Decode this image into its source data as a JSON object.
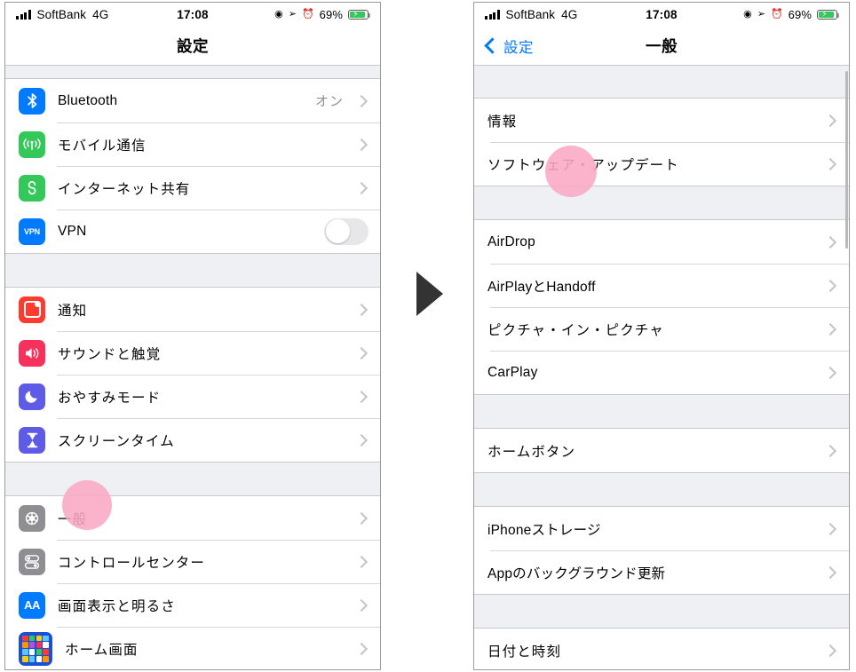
{
  "status_bar": {
    "carrier": "SoftBank",
    "network": "4G",
    "time": "17:08",
    "location_glyph": "◉",
    "navigation_glyph": "➢",
    "alarm_glyph": "⏰",
    "battery_percent": "69%",
    "battery_bolt": "⚡"
  },
  "colors": {
    "accent_blue": "#007aff",
    "highlight_pink": "#f9a8c3",
    "group_background": "#eff0f4",
    "separator": "#d6d6da",
    "chevron_gray": "#c4c4c6",
    "secondary_text": "#8e8e93"
  },
  "left_phone": {
    "nav": {
      "title": "設定"
    },
    "sections": [
      {
        "rows": [
          {
            "label": "Bluetooth",
            "value": "オン",
            "icon": "bluetooth-icon",
            "accessory": "chevron",
            "jp": false
          },
          {
            "label": "モバイル通信",
            "value": "",
            "icon": "cellular-icon",
            "accessory": "chevron",
            "jp": true
          },
          {
            "label": "インターネット共有",
            "value": "",
            "icon": "personal-hotspot-icon",
            "accessory": "chevron",
            "jp": true
          },
          {
            "label": "VPN",
            "value": "",
            "icon": "vpn-icon",
            "accessory": "toggle",
            "jp": false
          }
        ]
      },
      {
        "rows": [
          {
            "label": "通知",
            "value": "",
            "icon": "notifications-icon",
            "accessory": "chevron",
            "jp": true
          },
          {
            "label": "サウンドと触覚",
            "value": "",
            "icon": "sounds-haptics-icon",
            "accessory": "chevron",
            "jp": true
          },
          {
            "label": "おやすみモード",
            "value": "",
            "icon": "do-not-disturb-icon",
            "accessory": "chevron",
            "jp": true
          },
          {
            "label": "スクリーンタイム",
            "value": "",
            "icon": "screen-time-icon",
            "accessory": "chevron",
            "jp": true
          }
        ]
      },
      {
        "rows": [
          {
            "label": "一般",
            "value": "",
            "icon": "general-gear-icon",
            "accessory": "chevron",
            "jp": true
          },
          {
            "label": "コントロールセンター",
            "value": "",
            "icon": "control-center-icon",
            "accessory": "chevron",
            "jp": true
          },
          {
            "label": "画面表示と明るさ",
            "value": "",
            "icon": "display-brightness-icon",
            "accessory": "chevron",
            "jp": true
          },
          {
            "label": "ホーム画面",
            "value": "",
            "icon": "home-screen-icon",
            "accessory": "chevron",
            "jp": true
          }
        ]
      }
    ],
    "tap_highlight": {
      "label": "一般"
    }
  },
  "right_phone": {
    "nav": {
      "back_label": "設定",
      "title": "一般"
    },
    "sections": [
      {
        "rows": [
          {
            "label": "情報",
            "accessory": "chevron",
            "jp": true
          },
          {
            "label": "ソフトウェア・アップデート",
            "accessory": "chevron",
            "jp": true
          }
        ]
      },
      {
        "rows": [
          {
            "label": "AirDrop",
            "accessory": "chevron",
            "jp": false
          },
          {
            "label": "AirPlayとHandoff",
            "accessory": "chevron",
            "jp": false
          },
          {
            "label": "ピクチャ・イン・ピクチャ",
            "accessory": "chevron",
            "jp": true
          },
          {
            "label": "CarPlay",
            "accessory": "chevron",
            "jp": false
          }
        ]
      },
      {
        "rows": [
          {
            "label": "ホームボタン",
            "accessory": "chevron",
            "jp": true
          }
        ]
      },
      {
        "rows": [
          {
            "label": "iPhoneストレージ",
            "accessory": "chevron",
            "jp": false
          },
          {
            "label": "Appのバックグラウンド更新",
            "accessory": "chevron",
            "jp": false
          }
        ]
      },
      {
        "rows": [
          {
            "label": "日付と時刻",
            "accessory": "chevron",
            "jp": true
          }
        ]
      }
    ],
    "tap_highlight": {
      "label": "ソフトウェア・アップデート"
    }
  },
  "flow": {
    "arrow": "play-arrow-right"
  }
}
